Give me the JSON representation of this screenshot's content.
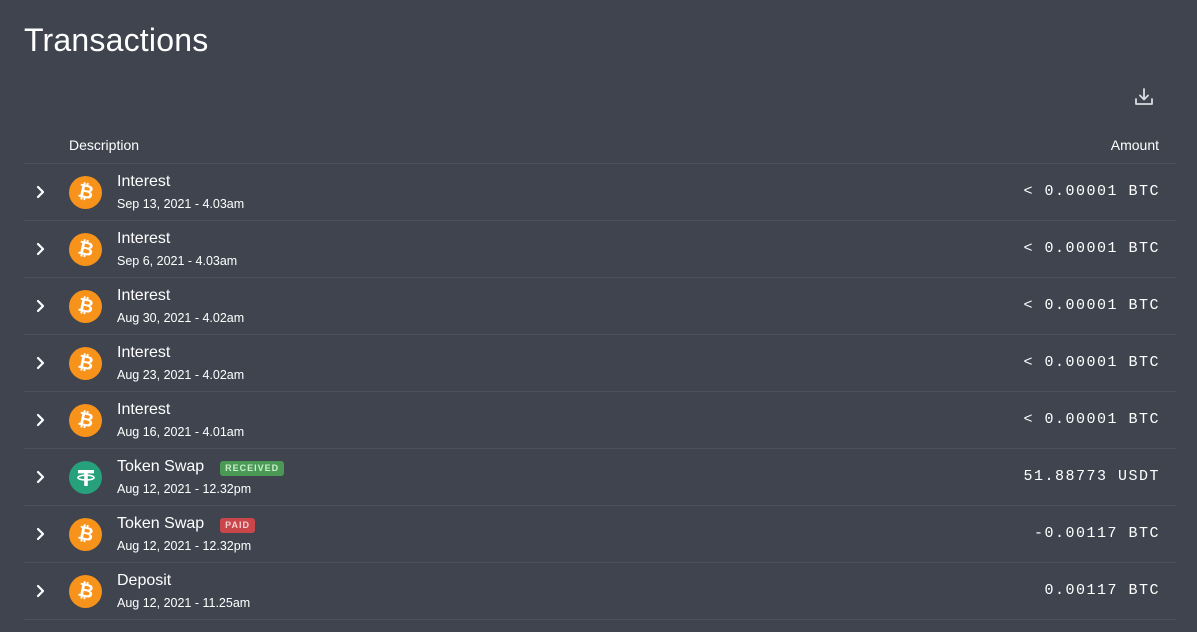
{
  "page": {
    "title": "Transactions"
  },
  "toolbar": {
    "download_icon": "download-icon"
  },
  "table": {
    "columns": {
      "description": "Description",
      "amount": "Amount"
    },
    "rows": [
      {
        "asset_icon": "bitcoin-icon",
        "name": "Interest",
        "badge": "",
        "date": "Sep 13, 2021 - 4.03am",
        "amount": "< 0.00001 BTC"
      },
      {
        "asset_icon": "bitcoin-icon",
        "name": "Interest",
        "badge": "",
        "date": "Sep 6, 2021 - 4.03am",
        "amount": "< 0.00001 BTC"
      },
      {
        "asset_icon": "bitcoin-icon",
        "name": "Interest",
        "badge": "",
        "date": "Aug 30, 2021 - 4.02am",
        "amount": "< 0.00001 BTC"
      },
      {
        "asset_icon": "bitcoin-icon",
        "name": "Interest",
        "badge": "",
        "date": "Aug 23, 2021 - 4.02am",
        "amount": "< 0.00001 BTC"
      },
      {
        "asset_icon": "bitcoin-icon",
        "name": "Interest",
        "badge": "",
        "date": "Aug 16, 2021 - 4.01am",
        "amount": "< 0.00001 BTC"
      },
      {
        "asset_icon": "tether-icon",
        "name": "Token Swap",
        "badge": "RECEIVED",
        "date": "Aug 12, 2021 - 12.32pm",
        "amount": "51.88773 USDT"
      },
      {
        "asset_icon": "bitcoin-icon",
        "name": "Token Swap",
        "badge": "PAID",
        "date": "Aug 12, 2021 - 12.32pm",
        "amount": "-0.00117 BTC"
      },
      {
        "asset_icon": "bitcoin-icon",
        "name": "Deposit",
        "badge": "",
        "date": "Aug 12, 2021 - 11.25am",
        "amount": "0.00117 BTC"
      }
    ]
  },
  "colors": {
    "background": "#3f444f",
    "divider": "#4b505b",
    "bitcoin": "#f7931a",
    "tether": "#26a17b",
    "badge_received": "#4a9a55",
    "badge_paid": "#c9464a"
  }
}
